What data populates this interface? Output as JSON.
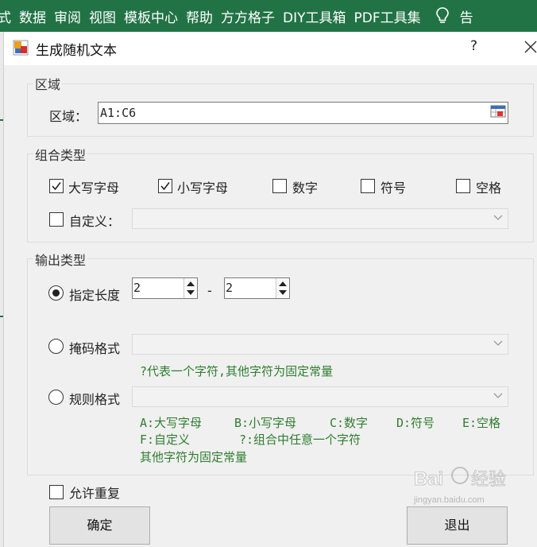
{
  "ribbon": {
    "tabs": [
      "式",
      "数据",
      "审阅",
      "视图",
      "模板中心",
      "帮助",
      "方方格子",
      "DIY工具箱",
      "PDF工具集"
    ],
    "cut_tab": "告",
    "icons": [
      "lightbulb-icon"
    ]
  },
  "dialog": {
    "title": "生成随机文本",
    "help": "?",
    "icons": [
      "app-icon",
      "close-icon"
    ]
  },
  "region": {
    "group_label": "区域",
    "field_label": "区域：",
    "value": "A1:C6",
    "icons": [
      "range-select-icon"
    ]
  },
  "combo_type": {
    "group_label": "组合类型",
    "options": [
      {
        "label": "大写字母",
        "checked": true
      },
      {
        "label": "小写字母",
        "checked": true
      },
      {
        "label": "数字",
        "checked": false
      },
      {
        "label": "符号",
        "checked": false
      },
      {
        "label": "空格",
        "checked": false
      }
    ],
    "custom": {
      "label": "自定义：",
      "checked": false,
      "value": ""
    }
  },
  "output_type": {
    "group_label": "输出类型",
    "fixed_length": {
      "label": "指定长度",
      "selected": true,
      "min": "2",
      "separator": "-",
      "max": "2"
    },
    "mask_format": {
      "label": "掩码格式",
      "selected": false,
      "value": "",
      "hint": "?代表一个字符,其他字符为固定常量"
    },
    "rule_format": {
      "label": "规则格式",
      "selected": false,
      "value": "",
      "hint_line1": [
        "A:大写字母",
        "B:小写字母",
        "C:数字",
        "D:符号",
        "E:空格"
      ],
      "hint_line2": [
        "F:自定义",
        "?:组合中任意一个字符"
      ],
      "hint_line3": "其他字符为固定常量"
    }
  },
  "allow_repeat": {
    "label": "允许重复",
    "checked": false
  },
  "buttons": {
    "ok": "确定",
    "exit": "退出"
  },
  "watermark": {
    "brand": "Baidu 经验",
    "url": "jingyan.baidu.com"
  }
}
